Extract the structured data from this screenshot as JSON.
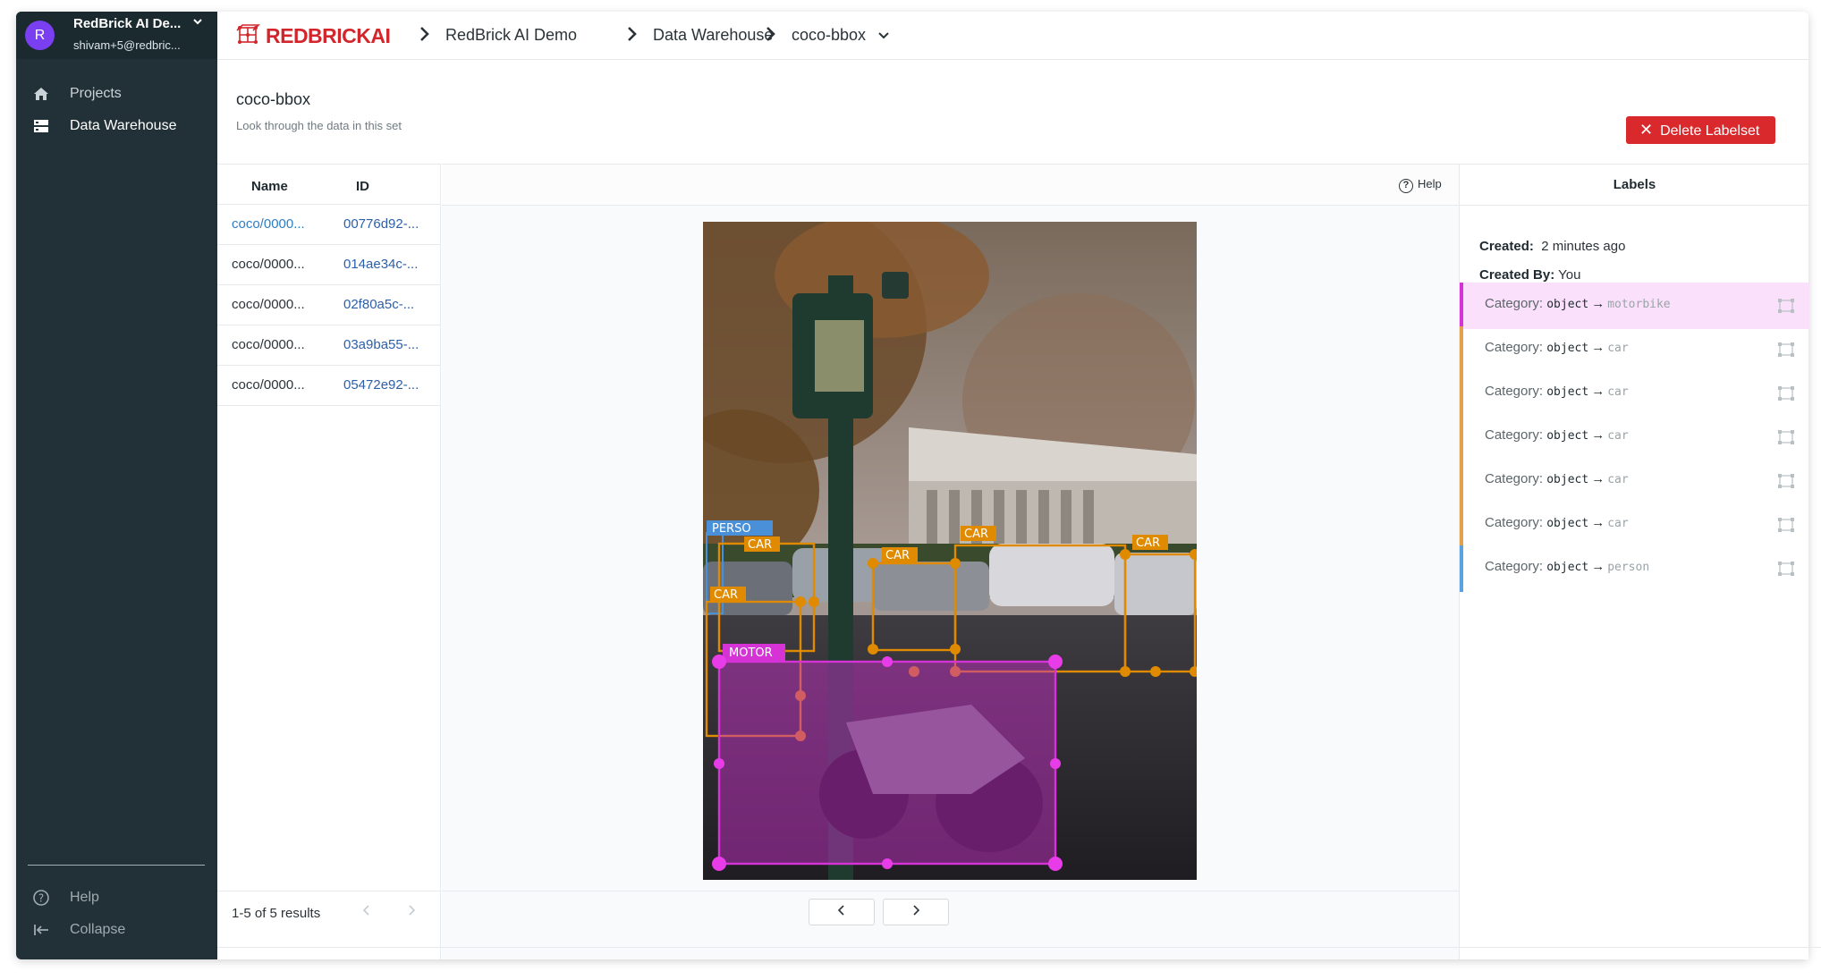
{
  "org": {
    "avatar_letter": "R",
    "name": "RedBrick AI De...",
    "email": "shivam+5@redbric..."
  },
  "sidebar": {
    "items": [
      {
        "label": "Projects"
      },
      {
        "label": "Data Warehouse"
      }
    ],
    "bottom": [
      {
        "label": "Help"
      },
      {
        "label": "Collapse"
      }
    ]
  },
  "logo": {
    "red": "REDBRICK",
    "black": "AI"
  },
  "breadcrumb": [
    "RedBrick AI Demo",
    "Data Warehouse",
    "coco-bbox"
  ],
  "page": {
    "title": "coco-bbox",
    "subtitle": "Look through the data in this set",
    "delete_label": "Delete Labelset"
  },
  "filelist": {
    "headers": [
      "Name",
      "ID"
    ],
    "rows": [
      {
        "name": "coco/0000...",
        "id": "00776d92-..."
      },
      {
        "name": "coco/0000...",
        "id": "014ae34c-..."
      },
      {
        "name": "coco/0000...",
        "id": "02f80a5c-..."
      },
      {
        "name": "coco/0000...",
        "id": "03a9ba55-..."
      },
      {
        "name": "coco/0000...",
        "id": "05472e92-..."
      }
    ],
    "footer": "1-5 of 5 results"
  },
  "viewer": {
    "help": "Help"
  },
  "annotations": {
    "person": "PERSO",
    "car": "CAR",
    "motor": "MOTOR"
  },
  "labels_panel": {
    "title": "Labels",
    "created_key": "Created:",
    "created_val": "2 minutes ago",
    "created_by_key": "Created By:",
    "created_by_val": "You",
    "category_key": "Category:",
    "object_word": "object",
    "arrow": "→",
    "items": [
      {
        "value": "motorbike",
        "color": "#d633d6"
      },
      {
        "value": "car",
        "color": "#e3a14b"
      },
      {
        "value": "car",
        "color": "#e3a14b"
      },
      {
        "value": "car",
        "color": "#e3a14b"
      },
      {
        "value": "car",
        "color": "#e3a14b"
      },
      {
        "value": "car",
        "color": "#e3a14b"
      },
      {
        "value": "person",
        "color": "#5aa2e0"
      }
    ]
  },
  "colors": {
    "sidebar": "#223137",
    "accent_red": "#d9292d",
    "motor": "#d633d6",
    "car": "#e08a00",
    "person": "#4a90d9"
  }
}
